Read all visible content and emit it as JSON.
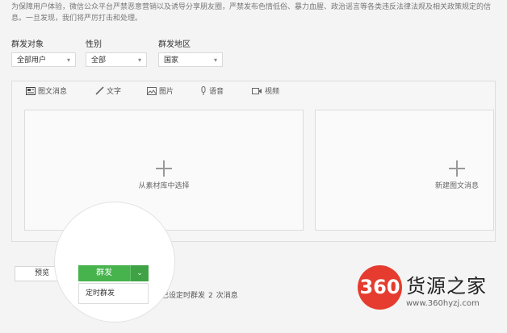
{
  "notice": "为保障用户体验，微信公众平台严禁恶意营销以及诱导分享朋友圈，严禁发布色情低俗、暴力血腥、政治谣言等各类违反法律法规及相关政策规定的信息。一旦发现，我们将严厉打击和处理。",
  "filters": {
    "target": {
      "label": "群发对象",
      "value": "全部用户"
    },
    "gender": {
      "label": "性别",
      "value": "全部"
    },
    "region": {
      "label": "群发地区",
      "value": "国家"
    }
  },
  "tabs": [
    {
      "label": "图文消息",
      "icon": "news-icon"
    },
    {
      "label": "文字",
      "icon": "pen-icon"
    },
    {
      "label": "图片",
      "icon": "image-icon"
    },
    {
      "label": "语音",
      "icon": "mic-icon"
    },
    {
      "label": "视频",
      "icon": "video-icon"
    }
  ],
  "panels": {
    "left": "从素材库中选择",
    "right": "新建图文消息"
  },
  "actions": {
    "preview": "预览",
    "send": "群发",
    "send_menu_item": "定时群发"
  },
  "status": {
    "prefix": "已设定时群发",
    "count": "2",
    "suffix": "次消息"
  },
  "watermark": {
    "badge": "360",
    "title": "货源之家",
    "url": "www.360hyzj.com"
  },
  "colors": {
    "send_green": "#47b34d",
    "watermark_red": "#e53c2f"
  }
}
